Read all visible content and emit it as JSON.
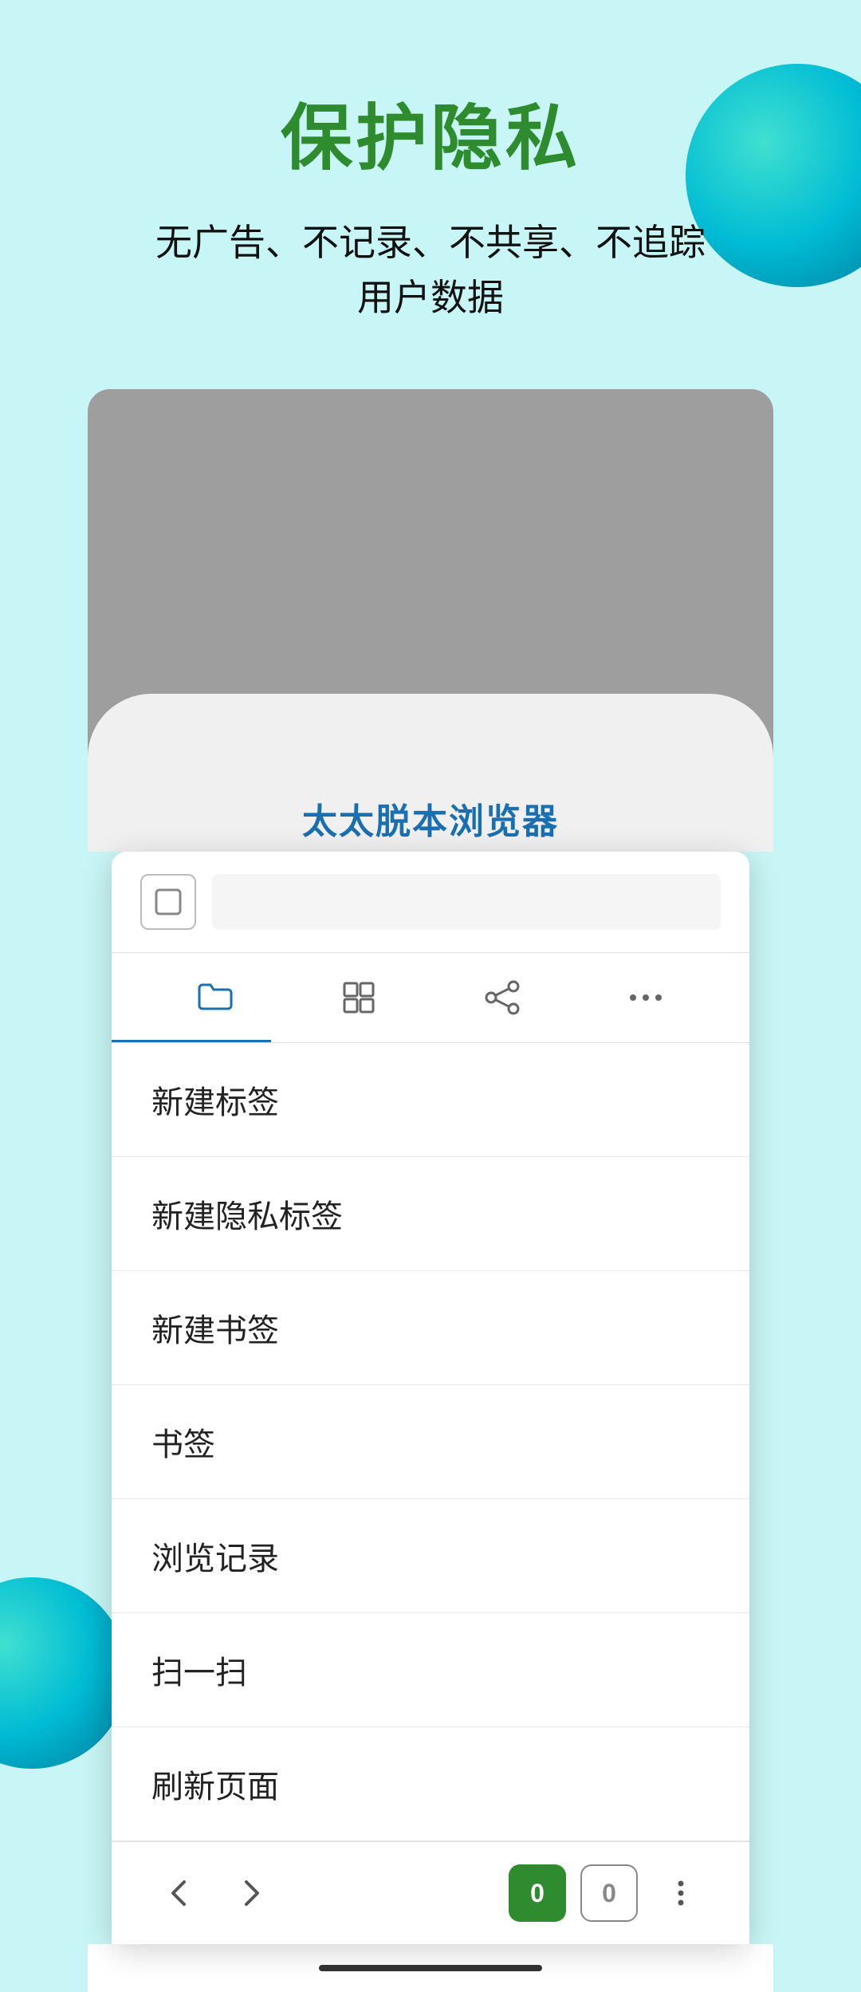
{
  "hero": {
    "title": "保护隐私",
    "subtitle_line1": "无广告、不记录、不共享、不追踪",
    "subtitle_line2": "用户数据"
  },
  "browser": {
    "app_title": "太太脱本浏览器"
  },
  "popup": {
    "address_placeholder": "",
    "icon_bar": [
      {
        "icon": "folder",
        "label": ""
      },
      {
        "icon": "scan",
        "label": ""
      },
      {
        "icon": "share",
        "label": ""
      },
      {
        "icon": "more",
        "label": ""
      }
    ],
    "menu_items": [
      {
        "label": "新建标签"
      },
      {
        "label": "新建隐私标签"
      },
      {
        "label": "新建书签"
      },
      {
        "label": "书签"
      },
      {
        "label": "浏览记录"
      },
      {
        "label": "扫一扫"
      },
      {
        "label": "刷新页面"
      }
    ]
  },
  "bottom_nav": {
    "back_label": "‹",
    "forward_label": "›",
    "tab_count_green": "0",
    "tab_count_outline": "0",
    "more_label": "⋮"
  },
  "decorative": {
    "ball_color": "#00bcd4"
  }
}
